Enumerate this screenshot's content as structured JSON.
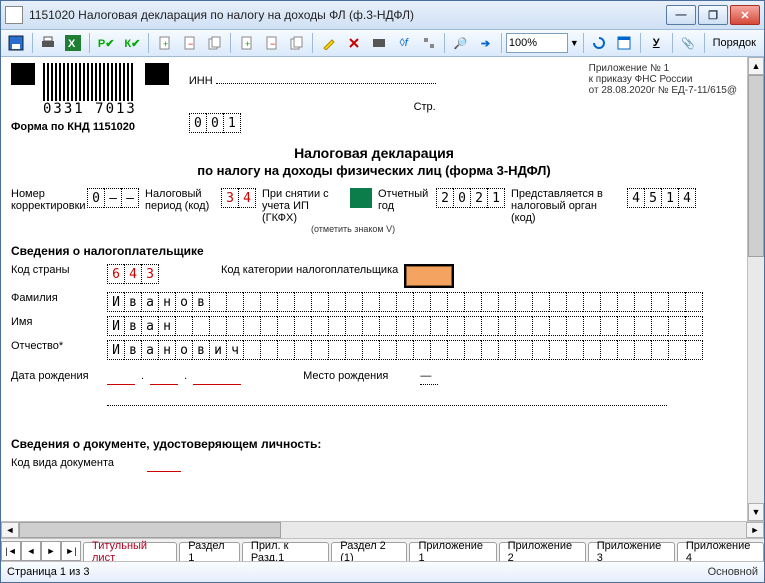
{
  "window": {
    "title": "1151020  Налоговая декларация по налогу на доходы ФЛ (ф.3-НДФЛ)"
  },
  "toolbar": {
    "zoom": "100%",
    "order": "Порядок"
  },
  "header_right": {
    "line1": "Приложение № 1",
    "line2": "к приказу ФНС России",
    "line3": "от 28.08.2020г № ЕД-7-11/615@"
  },
  "inn_label": "ИНН",
  "page_label": "Стр.",
  "page_digits": [
    "0",
    "0",
    "1"
  ],
  "barcode_number": "0331 7013",
  "knd": "Форма по КНД 1151020",
  "titles": {
    "main": "Налоговая декларация",
    "sub": "по налогу на доходы физических лиц (форма 3-НДФЛ)"
  },
  "row1": {
    "corr_label": "Номер корректировки",
    "corr_vals": [
      "0",
      "—",
      "—"
    ],
    "period_label": "Налоговый период (код)",
    "period_vals": [
      "3",
      "4"
    ],
    "ip_label": "При снятии с учета ИП (ГКФХ)",
    "ip_note": "(отметить знаком V)",
    "year_label": "Отчетный год",
    "year_vals": [
      "2",
      "0",
      "2",
      "1"
    ],
    "organ_label": "Представляется в налоговый орган (код)",
    "organ_vals": [
      "4",
      "5",
      "1",
      "4"
    ]
  },
  "section1": "Сведения о налогоплательщике",
  "taxpayer": {
    "country_label": "Код страны",
    "country_vals": [
      "6",
      "4",
      "3"
    ],
    "category_label": "Код категории налогоплательщика",
    "lastname_label": "Фамилия",
    "lastname": "Иванов",
    "firstname_label": "Имя",
    "firstname": "Иван",
    "middlename_label": "Отчество*",
    "middlename": "Иванович",
    "dob_label": "Дата рождения",
    "pob_label": "Место рождения"
  },
  "section2": "Сведения о документе, удостоверяющем личность:",
  "doc": {
    "type_label": "Код вида документа"
  },
  "tabs": [
    "Титульный лист",
    "Раздел 1",
    "Прил. к Разд.1",
    "Раздел 2 (1)",
    "Приложение 1",
    "Приложение 2",
    "Приложение 3",
    "Приложение 4"
  ],
  "status": {
    "left": "Страница 1 из 3",
    "right": "Основной"
  }
}
